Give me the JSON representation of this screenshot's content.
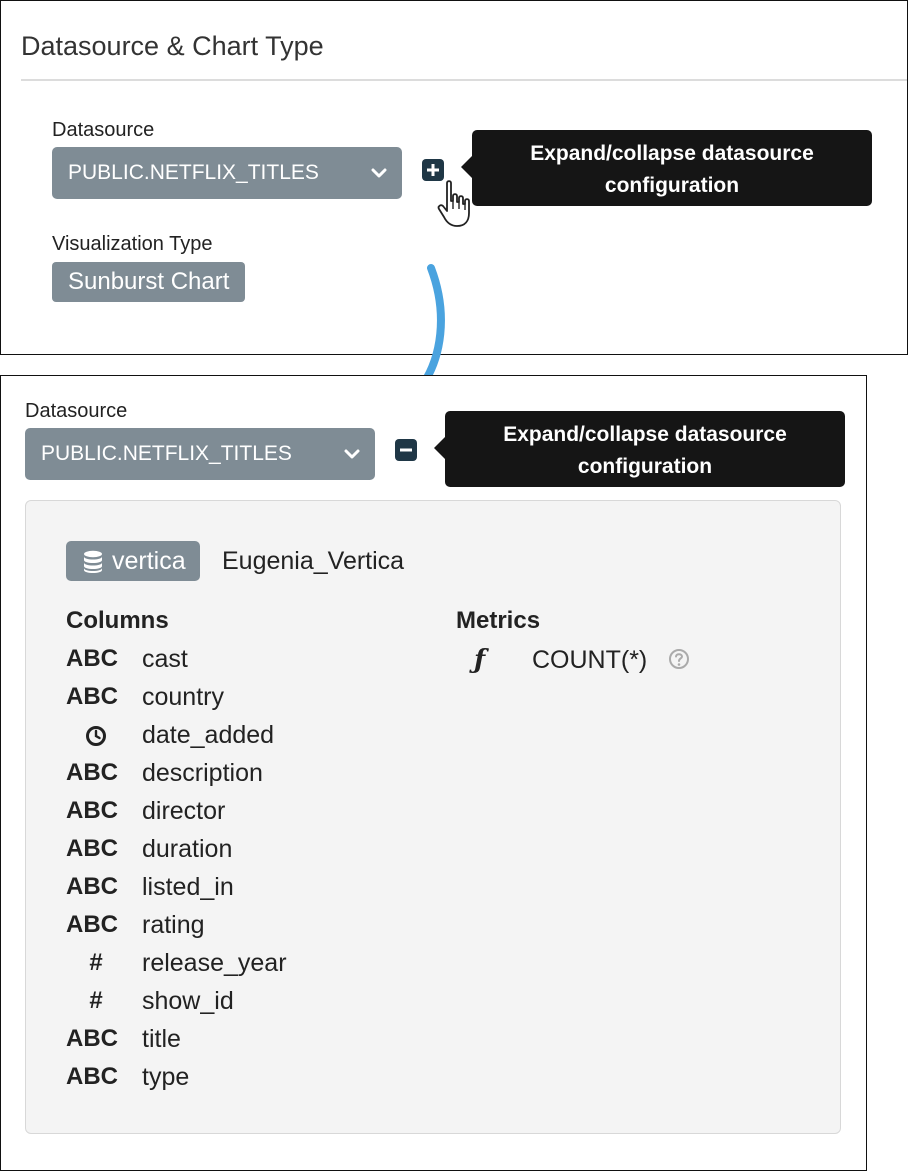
{
  "top_panel": {
    "section_title": "Datasource & Chart Type",
    "datasource_label": "Datasource",
    "datasource_value": "PUBLIC.NETFLIX_TITLES",
    "toggle_state": "collapsed",
    "tooltip": "Expand/collapse datasource configuration",
    "viz_label": "Visualization Type",
    "viz_value": "Sunburst Chart"
  },
  "bottom_panel": {
    "datasource_label": "Datasource",
    "datasource_value": "PUBLIC.NETFLIX_TITLES",
    "toggle_state": "expanded",
    "tooltip": "Expand/collapse datasource configuration",
    "config": {
      "badge_icon": "database-icon",
      "badge_label": "vertica",
      "datasource_name": "Eugenia_Vertica",
      "columns_heading": "Columns",
      "metrics_heading": "Metrics",
      "columns": [
        {
          "type": "ABC",
          "name": "cast"
        },
        {
          "type": "ABC",
          "name": "country"
        },
        {
          "type": "clock-icon",
          "name": "date_added"
        },
        {
          "type": "ABC",
          "name": "description"
        },
        {
          "type": "ABC",
          "name": "director"
        },
        {
          "type": "ABC",
          "name": "duration"
        },
        {
          "type": "ABC",
          "name": "listed_in"
        },
        {
          "type": "ABC",
          "name": "rating"
        },
        {
          "type": "#",
          "name": "release_year"
        },
        {
          "type": "#",
          "name": "show_id"
        },
        {
          "type": "ABC",
          "name": "title"
        },
        {
          "type": "ABC",
          "name": "type"
        }
      ],
      "metrics": [
        {
          "icon": "ƒ",
          "name": "COUNT(*)",
          "help_icon": "question-circle-icon"
        }
      ]
    }
  },
  "colors": {
    "select_bg": "#7f8c95",
    "toggle_bg": "#1f3746",
    "tooltip_bg": "#151515",
    "arrow": "#4aa3df",
    "config_bg": "#f4f4f4"
  }
}
